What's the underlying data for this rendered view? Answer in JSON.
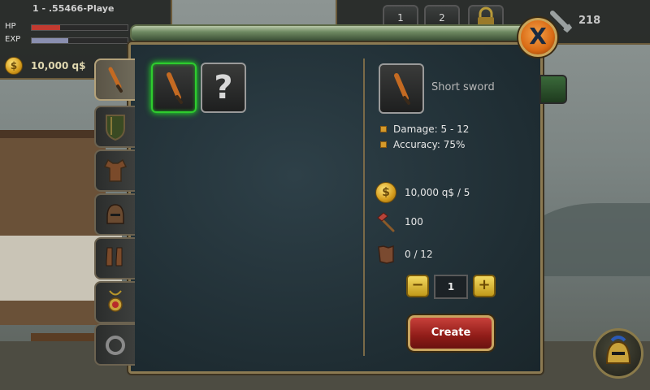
{
  "player": {
    "name": "1 - .55466-Playe",
    "hp_label": "HP",
    "exp_label": "EXP",
    "hp_fraction": 0.3,
    "exp_fraction": 0.38,
    "gold": "10,000 q$"
  },
  "top_hud": {
    "slots": [
      "1",
      "2"
    ],
    "sword_count": "218"
  },
  "dialog": {
    "close_label": "X",
    "categories": [
      {
        "icon": "dagger-icon",
        "active": true
      },
      {
        "icon": "shield-icon",
        "active": false
      },
      {
        "icon": "armor-icon",
        "active": false
      },
      {
        "icon": "helmet-icon",
        "active": false
      },
      {
        "icon": "boots-icon",
        "active": false
      },
      {
        "icon": "amulet-icon",
        "active": false
      },
      {
        "icon": "ring-icon",
        "active": false
      }
    ],
    "items": [
      {
        "icon": "short-sword-icon",
        "selected": true
      },
      {
        "icon": "unknown-item-icon",
        "label": "?",
        "selected": false
      }
    ],
    "detail": {
      "name": "Short sword",
      "stats": [
        "Damage: 5 - 12",
        "Accuracy: 75%"
      ],
      "cost": "10,000 q$ / 5",
      "hammer": "100",
      "materials": "0 / 12",
      "quantity": "1",
      "minus_label": "−",
      "plus_label": "+",
      "create_label": "Create"
    }
  },
  "colors": {
    "accent_gold": "#d39a1b",
    "create_red": "#a82420",
    "selected_green": "#2ecc2e"
  }
}
